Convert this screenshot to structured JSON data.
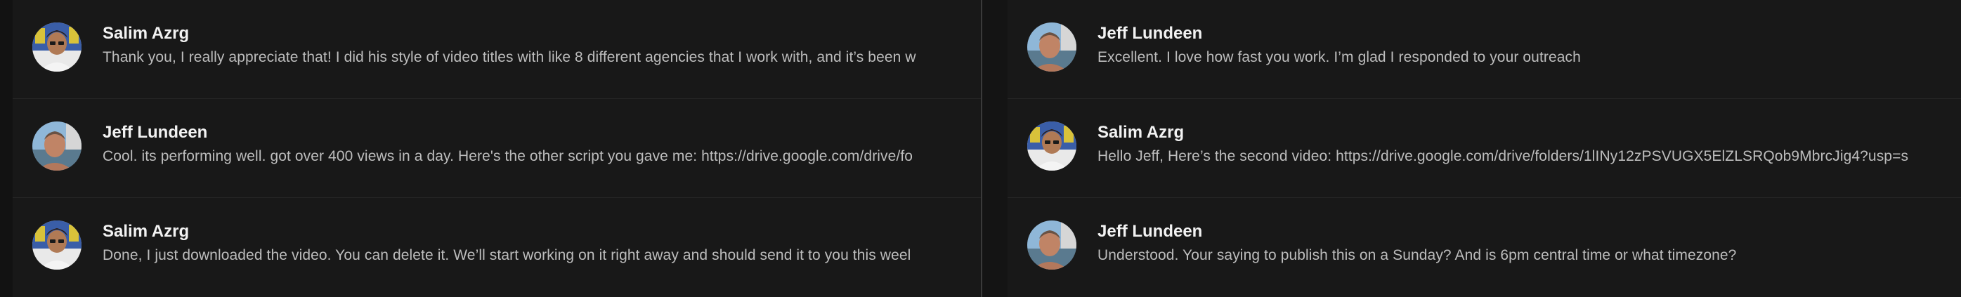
{
  "left_pane": {
    "messages": [
      {
        "sender": "Salim Azrg",
        "avatar": "salim-avatar",
        "text": "Thank you, I really appreciate that! I did his style of video titles with like 8 different agencies that I work with, and it’s been w"
      },
      {
        "sender": "Jeff Lundeen",
        "avatar": "jeff-avatar",
        "text": "Cool. its performing well. got over 400 views in a day. Here's the other script you gave me: https://drive.google.com/drive/fo"
      },
      {
        "sender": "Salim Azrg",
        "avatar": "salim-avatar",
        "text": "Done, I just downloaded the video. You can delete it. We’ll start working on it right away and should send it to you this weel"
      }
    ]
  },
  "right_pane": {
    "messages": [
      {
        "sender": "Jeff Lundeen",
        "avatar": "jeff-avatar",
        "text": "Excellent. I love how fast you work. I’m glad I responded to your outreach"
      },
      {
        "sender": "Salim Azrg",
        "avatar": "salim-avatar",
        "text": "Hello Jeff, Here’s the second video: https://drive.google.com/drive/folders/1lINy12zPSVUGX5ElZLSRQob9MbrcJig4?usp=s"
      },
      {
        "sender": "Jeff Lundeen",
        "avatar": "jeff-avatar",
        "text": "Understood. Your saying to publish this on a Sunday? And is 6pm central time or what timezone?"
      }
    ]
  },
  "colors": {
    "background": "#181818",
    "divider": "#3a3a3a",
    "name_text": "#f2f2f2",
    "message_text": "#bdbdbd"
  }
}
